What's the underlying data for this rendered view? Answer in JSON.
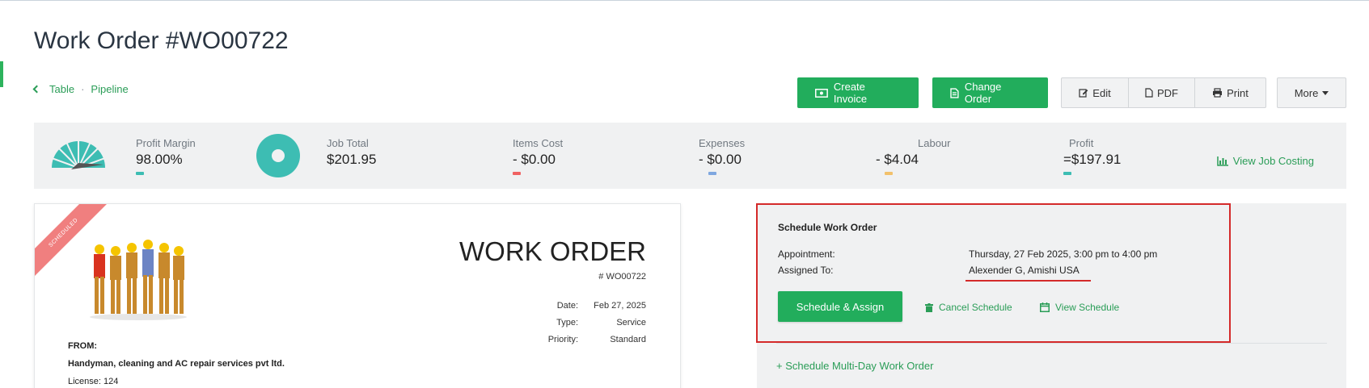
{
  "page": {
    "title": "Work Order #WO00722",
    "breadcrumb": {
      "table": "Table",
      "pipeline": "Pipeline"
    }
  },
  "toolbar": {
    "create_invoice": "Create Invoice",
    "change_order": "Change Order",
    "edit": "Edit",
    "pdf": "PDF",
    "print": "Print",
    "more": "More"
  },
  "stats": {
    "profit_margin": {
      "label": "Profit Margin",
      "value": "98.00%"
    },
    "job_total": {
      "label": "Job Total",
      "value": "$201.95"
    },
    "items_cost": {
      "label": "Items Cost",
      "value": "- $0.00"
    },
    "expenses": {
      "label": "Expenses",
      "value": "- $0.00"
    },
    "labour": {
      "label": "Labour",
      "value": "- $4.04"
    },
    "profit": {
      "label": "Profit",
      "value": "=$197.91"
    },
    "view_costing": "View Job Costing",
    "colors": {
      "teal": "#3dbdb3",
      "red": "#f06262",
      "blue": "#7fa7e0",
      "yellow": "#f2c16b"
    }
  },
  "document": {
    "ribbon": "SCHEDULED",
    "heading": "WORK ORDER",
    "number": "# WO00722",
    "meta": [
      {
        "key": "Date:",
        "value": "Feb 27, 2025"
      },
      {
        "key": "Type:",
        "value": "Service"
      },
      {
        "key": "Priority:",
        "value": "Standard"
      }
    ],
    "from_label": "FROM:",
    "company": "Handyman, cleaning and AC repair services pvt ltd.",
    "license": "License: 124"
  },
  "schedule": {
    "title": "Schedule Work Order",
    "appointment_label": "Appointment:",
    "appointment_value": "Thursday, 27 Feb 2025, 3:00 pm to 4:00 pm",
    "assigned_label": "Assigned To:",
    "assigned_value": "Alexender G, Amishi USA",
    "schedule_assign": "Schedule & Assign",
    "cancel": "Cancel Schedule",
    "view": "View Schedule",
    "multi_day": "+ Schedule Multi-Day Work Order"
  }
}
